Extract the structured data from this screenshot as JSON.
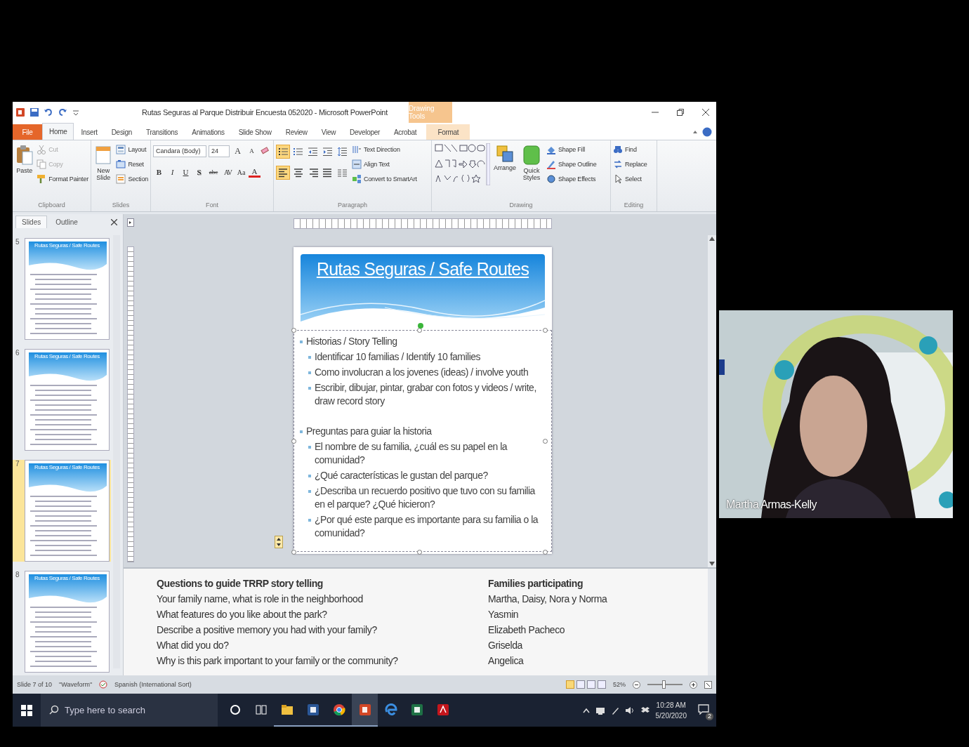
{
  "title_bar": {
    "title": "Rutas Seguras al Parque Distribuir Encuesta 052020 - Microsoft PowerPoint",
    "contextual_tab": "Drawing Tools"
  },
  "ribbon_tabs": [
    {
      "label": "File",
      "kind": "file",
      "selected": false
    },
    {
      "label": "Home",
      "kind": "tab",
      "selected": true
    },
    {
      "label": "Insert",
      "kind": "tab",
      "selected": false
    },
    {
      "label": "Design",
      "kind": "tab",
      "selected": false
    },
    {
      "label": "Transitions",
      "kind": "tab",
      "selected": false
    },
    {
      "label": "Animations",
      "kind": "tab",
      "selected": false
    },
    {
      "label": "Slide Show",
      "kind": "tab",
      "selected": false
    },
    {
      "label": "Review",
      "kind": "tab",
      "selected": false
    },
    {
      "label": "View",
      "kind": "tab",
      "selected": false
    },
    {
      "label": "Developer",
      "kind": "tab",
      "selected": false
    },
    {
      "label": "Acrobat",
      "kind": "tab",
      "selected": false
    },
    {
      "label": "Format",
      "kind": "contextual",
      "selected": false
    }
  ],
  "ribbon": {
    "clipboard": {
      "label": "Clipboard",
      "paste": "Paste",
      "commands": [
        {
          "label": "Cut",
          "disabled": true
        },
        {
          "label": "Copy",
          "disabled": true
        },
        {
          "label": "Format Painter",
          "disabled": false
        }
      ]
    },
    "slides": {
      "label": "Slides",
      "new_slide": "New Slide",
      "commands": [
        "Layout",
        "Reset",
        "Section"
      ]
    },
    "font": {
      "label": "Font",
      "font_name": "Candara (Body)",
      "font_size": "24",
      "grow": "A",
      "shrink": "A",
      "formats": [
        "B",
        "I",
        "U",
        "S",
        "abc",
        "AV",
        "Aa",
        "A"
      ]
    },
    "paragraph": {
      "label": "Paragraph",
      "list_buttons": [
        {
          "selected": true
        },
        {
          "selected": false
        },
        {
          "selected": false
        },
        {
          "selected": false
        },
        {
          "selected": false
        }
      ],
      "align_buttons": [
        {
          "selected": true
        },
        {
          "selected": false
        },
        {
          "selected": false
        },
        {
          "selected": false
        },
        {
          "selected": false
        }
      ],
      "commands": [
        "Text Direction",
        "Align Text",
        "Convert to SmartArt"
      ]
    },
    "drawing": {
      "label": "Drawing",
      "arrange": "Arrange",
      "quick_styles": "Quick Styles",
      "commands": [
        "Shape Fill",
        "Shape Outline",
        "Shape Effects"
      ]
    },
    "editing": {
      "label": "Editing",
      "commands": [
        "Find",
        "Replace",
        "Select"
      ]
    }
  },
  "slides_pane": {
    "tabs": [
      {
        "label": "Slides",
        "selected": true
      },
      {
        "label": "Outline",
        "selected": false
      }
    ],
    "thumbnails": [
      {
        "number": "5",
        "title": "Rutas Seguras / Safe Routes",
        "selected": false
      },
      {
        "number": "6",
        "title": "Rutas Seguras / Safe Routes",
        "selected": false
      },
      {
        "number": "7",
        "title": "Rutas Seguras / Safe Routes",
        "selected": true
      },
      {
        "number": "8",
        "title": "Rutas Seguras / Safe Routes",
        "selected": false
      }
    ]
  },
  "slide": {
    "title": "Rutas Seguras / Safe Routes",
    "bullets": [
      {
        "text": "Historias / Story Telling",
        "children": [
          {
            "text": "Identificar 10 familias / Identify 10 families"
          },
          {
            "text": "Como involucran a los jovenes (ideas) / involve youth"
          },
          {
            "text": "Escribir, dibujar, pintar, grabar con fotos y videos / write, draw record story"
          }
        ]
      },
      {
        "text": "Preguntas para guiar la historia",
        "children": [
          {
            "text": "El nombre de su familia, ¿cuál es su papel en la comunidad?"
          },
          {
            "text": "¿Qué características le gustan del parque?"
          },
          {
            "text": "¿Describa un recuerdo positivo que tuvo con su familia en el parque? ¿Qué hicieron?"
          },
          {
            "text": "¿Por qué este parque es importante para su familia o la comunidad?"
          }
        ]
      }
    ]
  },
  "notes": {
    "columns": [
      {
        "heading": "Questions to guide TRRP story telling",
        "lines": [
          "Your family name, what is role in the neighborhood",
          "What features  do you like about the park?",
          "Describe a positive memory you had with your family?",
          "What did you do?",
          "Why is this park important to your family or the community?"
        ]
      },
      {
        "heading": "Families participating",
        "lines": [
          "Martha, Daisy, Nora y Norma",
          "Yasmin",
          "Elizabeth Pacheco",
          "Griselda",
          "Angelica"
        ]
      }
    ]
  },
  "status_bar": {
    "slide_info": "Slide 7 of 10",
    "theme": "\"Waveform\"",
    "language": "Spanish (International Sort)",
    "views": [
      {
        "selected": true
      },
      {
        "selected": false
      },
      {
        "selected": false
      },
      {
        "selected": false
      }
    ],
    "zoom": "52%",
    "level": 0.45
  },
  "taskbar": {
    "search": {
      "placeholder": "Type here to search"
    },
    "apps": [
      {
        "running": true,
        "selected": false
      },
      {
        "running": true,
        "selected": false
      },
      {
        "running": true,
        "selected": false
      },
      {
        "running": true,
        "selected": true
      },
      {
        "running": false,
        "selected": false
      },
      {
        "running": false,
        "selected": false
      },
      {
        "running": false,
        "selected": false
      }
    ],
    "time": "10:28 AM",
    "date": "5/20/2020",
    "notifications": "2"
  },
  "video": {
    "participant_name": "Martha Armas-Kelly"
  }
}
